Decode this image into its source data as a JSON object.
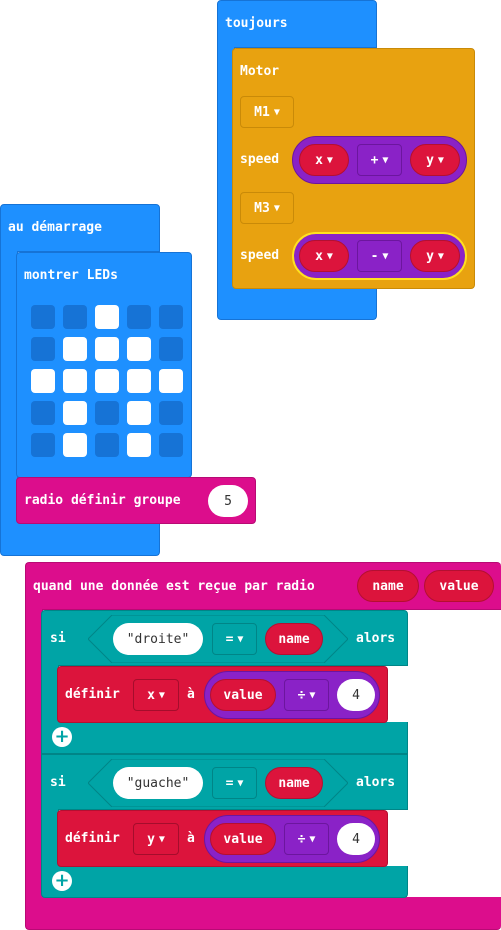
{
  "forever_block": {
    "title": "toujours",
    "motor_block": {
      "title": "Motor",
      "m1": "M1",
      "m3": "M3",
      "speed_label": "speed",
      "expr1": {
        "left": "x",
        "op": "+",
        "right": "y"
      },
      "expr2": {
        "left": "x",
        "op": "-",
        "right": "y"
      }
    }
  },
  "on_start_block": {
    "title": "au démarrage",
    "show_leds": {
      "title": "montrer LEDs",
      "grid": [
        [
          0,
          0,
          1,
          0,
          0
        ],
        [
          0,
          1,
          1,
          1,
          0
        ],
        [
          1,
          1,
          1,
          1,
          1
        ],
        [
          0,
          1,
          0,
          1,
          0
        ],
        [
          0,
          1,
          0,
          1,
          0
        ]
      ]
    },
    "radio_group": {
      "label": "radio définir groupe",
      "value": "5"
    }
  },
  "on_received_block": {
    "title": "quand une donnée est reçue par radio",
    "param1": "name",
    "param2": "value",
    "if1": {
      "si": "si",
      "string": "droite",
      "op": "=",
      "var": "name",
      "alors": "alors",
      "set": {
        "label": "définir",
        "var": "x",
        "a": "à",
        "left": "value",
        "op": "÷",
        "right": "4"
      }
    },
    "if2": {
      "si": "si",
      "string": "guache",
      "op": "=",
      "var": "name",
      "alors": "alors",
      "set": {
        "label": "définir",
        "var": "y",
        "a": "à",
        "left": "value",
        "op": "÷",
        "right": "4"
      }
    },
    "add_icon": "plus-icon",
    "caret_icon": "caret-down-icon"
  },
  "colors": {
    "basic": "#1e90ff",
    "motor": "#e8a210",
    "radio": "#dc0d8c",
    "logic": "#00a4a6",
    "variables": "#dc143c",
    "math": "#8a22c7"
  }
}
